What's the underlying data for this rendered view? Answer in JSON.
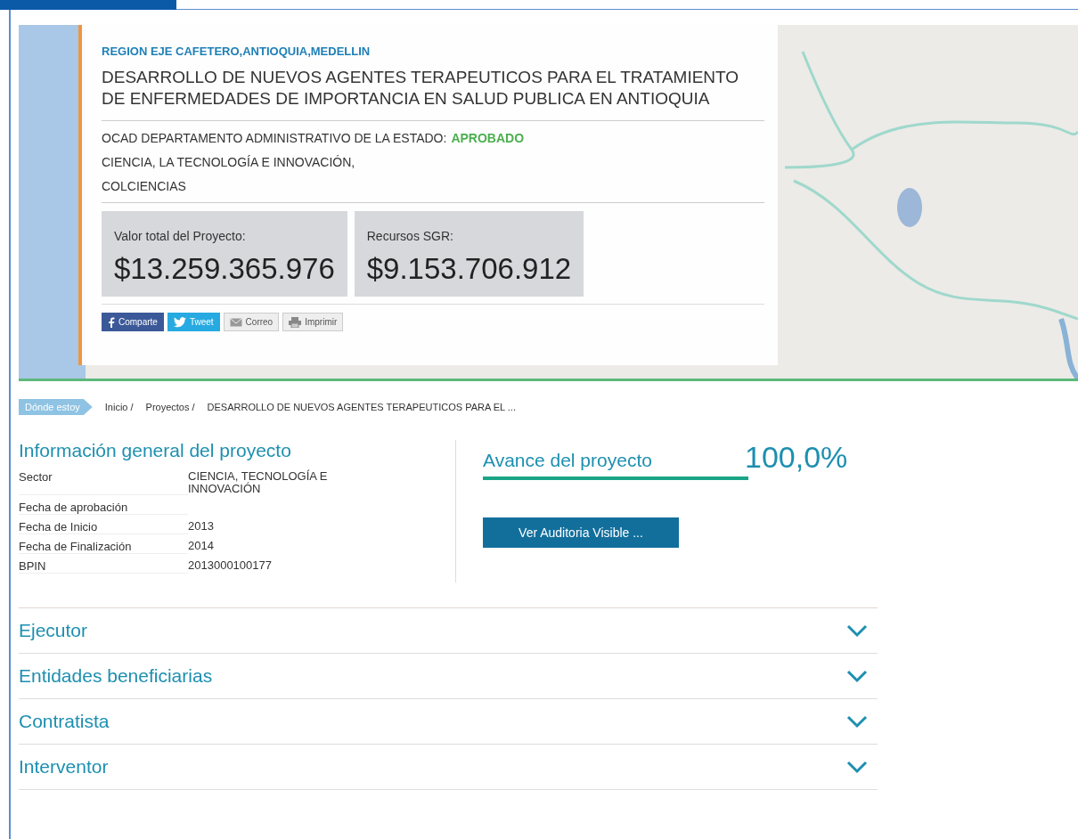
{
  "hero": {
    "region": "REGION EJE CAFETERO,ANTIOQUIA,MEDELLIN",
    "title": "DESARROLLO DE NUEVOS AGENTES TERAPEUTICOS PARA EL TRATAMIENTO DE ENFERMEDADES DE IMPORTANCIA EN SALUD PUBLICA EN ANTIOQUIA",
    "ocad": "OCAD DEPARTAMENTO ADMINISTRATIVO DE LA ESTADO:",
    "status": "APROBADO",
    "entity_lines": [
      "CIENCIA, LA TECNOLOGÍA E INNOVACIÓN,",
      "COLCIENCIAS"
    ],
    "amounts": [
      {
        "label": "Valor total del Proyecto:",
        "value": "$13.259.365.976"
      },
      {
        "label": "Recursos SGR:",
        "value": "$9.153.706.912"
      }
    ],
    "share_buttons": [
      {
        "kind": "facebook",
        "label": "Comparte"
      },
      {
        "kind": "twitter",
        "label": "Tweet"
      },
      {
        "kind": "mail",
        "label": "Correo"
      },
      {
        "kind": "print",
        "label": "Imprimir"
      }
    ]
  },
  "breadcrumb": {
    "tag": "Dónde estoy",
    "items": [
      "Inicio /",
      "Proyectos /",
      "DESARROLLO DE NUEVOS AGENTES TERAPEUTICOS PARA EL ..."
    ]
  },
  "general_info": {
    "title": "Información general del proyecto",
    "rows": [
      {
        "label": "Sector",
        "value": "CIENCIA, TECNOLOGÍA E INNOVACIÓN"
      },
      {
        "label": "Fecha de aprobación"
      },
      {
        "label": "Fecha de Inicio",
        "value": "2013"
      },
      {
        "label": "Fecha de Finalización",
        "value": "2014"
      },
      {
        "label": "BPIN",
        "value": "2013000100177"
      }
    ]
  },
  "progress": {
    "title": "Avance del proyecto",
    "reading": "100,0%",
    "level": 1.0,
    "button": "Ver Auditoria Visible ..."
  },
  "accordion": [
    {
      "label": "Ejecutor",
      "expanded": false
    },
    {
      "label": "Entidades beneficiarias",
      "expanded": false
    },
    {
      "label": "Contratista",
      "expanded": false
    },
    {
      "label": "Interventor",
      "expanded": false
    }
  ]
}
